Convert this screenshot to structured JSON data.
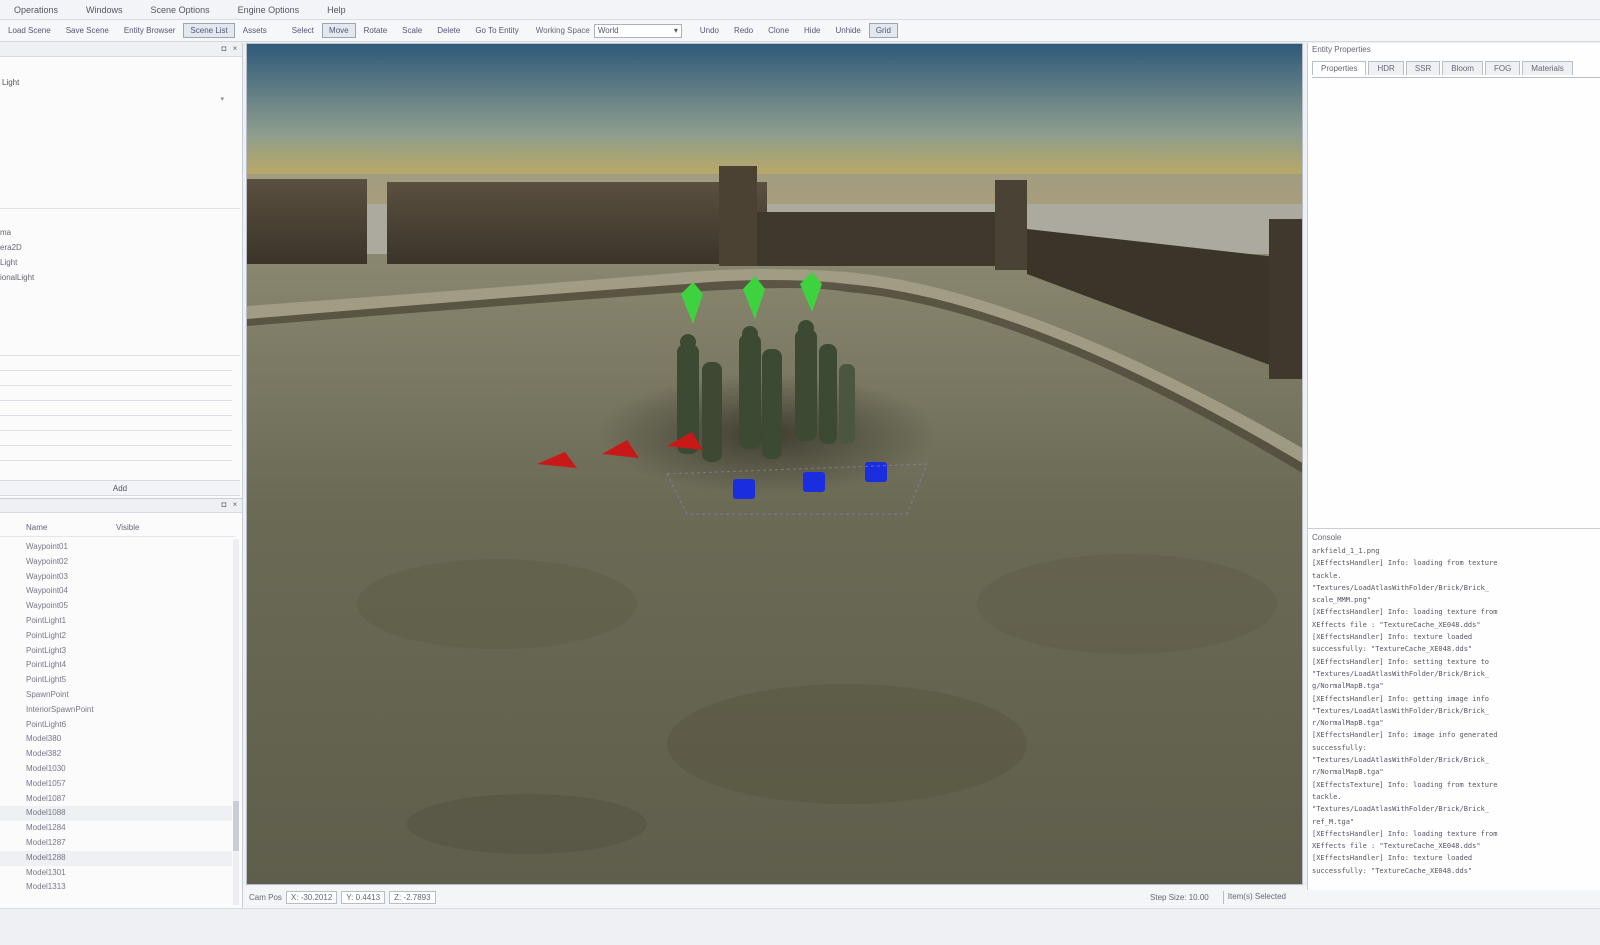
{
  "menu": [
    "Operations",
    "Windows",
    "Scene Options",
    "Engine Options",
    "Help"
  ],
  "toolbar": {
    "buttons_left": [
      "Load Scene",
      "Save Scene",
      "Entity Browser",
      "Scene List",
      "Assets"
    ],
    "buttons_mid": [
      "Select",
      "Move",
      "Rotate",
      "Scale",
      "Delete",
      "Go To Entity"
    ],
    "working_space_label": "Working Space",
    "working_space_value": "World",
    "buttons_right": [
      "Undo",
      "Redo",
      "Clone",
      "Hide",
      "Unhide",
      "Grid"
    ]
  },
  "left_top": {
    "light_field": "Light",
    "entities": [
      "ma",
      "era2D",
      "Light",
      "ionalLight"
    ],
    "add_label": "Add"
  },
  "left_bottom": {
    "col_name": "Name",
    "col_visible": "Visible",
    "objects": [
      "Waypoint01",
      "Waypoint02",
      "Waypoint03",
      "Waypoint04",
      "Waypoint05",
      "PointLight1",
      "PointLight2",
      "PointLight3",
      "PointLight4",
      "PointLight5",
      "SpawnPoint",
      "InteriorSpawnPoint",
      "PointLight6",
      "Model380",
      "Model382",
      "Model1030",
      "Model1057",
      "Model1087",
      "Model1088",
      "Model1284",
      "Model1287",
      "Model1288",
      "Model1301",
      "Model1313"
    ]
  },
  "statusbar": {
    "cam_pos_label": "Cam Pos",
    "x": "X: -30.2012",
    "y": "Y: 0.4413",
    "z": "Z: -2.7893",
    "step_size_label": "Step Size: 10.00",
    "selected_label": "Item(s) Selected"
  },
  "right_top": {
    "title": "Entity Properties",
    "tabs": [
      "Properties",
      "HDR",
      "SSR",
      "Bloom",
      "FOG",
      "Materials"
    ]
  },
  "right_bottom": {
    "title": "Console",
    "lines": [
      "arkfield_1_1.png",
      "[XEffectsHandler] Info: loading from texture",
      "tackle.",
      "\"Textures/LoadAtlasWithFolder/Brick/Brick_",
      "scale_MMM.png\"",
      "[XEffectsHandler] Info: loading texture from",
      "XEffects file : \"TextureCache_XE048.dds\"",
      "[XEffectsHandler] Info: texture loaded",
      "successfully: \"TextureCache_XE048.dds\"",
      "[XEffectsHandler] Info: setting texture to",
      "\"Textures/LoadAtlasWithFolder/Brick/Brick_",
      "g/NormalMapB.tga\"",
      "[XEffectsHandler] Info: getting image info",
      "\"Textures/LoadAtlasWithFolder/Brick/Brick_",
      "r/NormalMapB.tga\"",
      "[XEffectsHandler] Info: image info generated",
      "successfully:",
      "\"Textures/LoadAtlasWithFolder/Brick/Brick_",
      "r/NormalMapB.tga\"",
      "[XEffectsTexture] Info: loading from texture",
      "tackle.",
      "\"Textures/LoadAtlasWithFolder/Brick/Brick_",
      "ref_M.tga\"",
      "[XEffectsHandler] Info: loading texture from",
      "XEffects file : \"TextureCache_XE048.dds\"",
      "[XEffectsHandler] Info: texture loaded",
      "successfully: \"TextureCache_XE048.dds\""
    ]
  },
  "colors": {
    "gizmo_green": "#3fd23f",
    "gizmo_red": "#c81818",
    "gizmo_blue": "#1a2ee0",
    "sky_top": "#2f5a7a",
    "sky_horizon": "#d9b04a",
    "ground": "#6b6a55"
  }
}
